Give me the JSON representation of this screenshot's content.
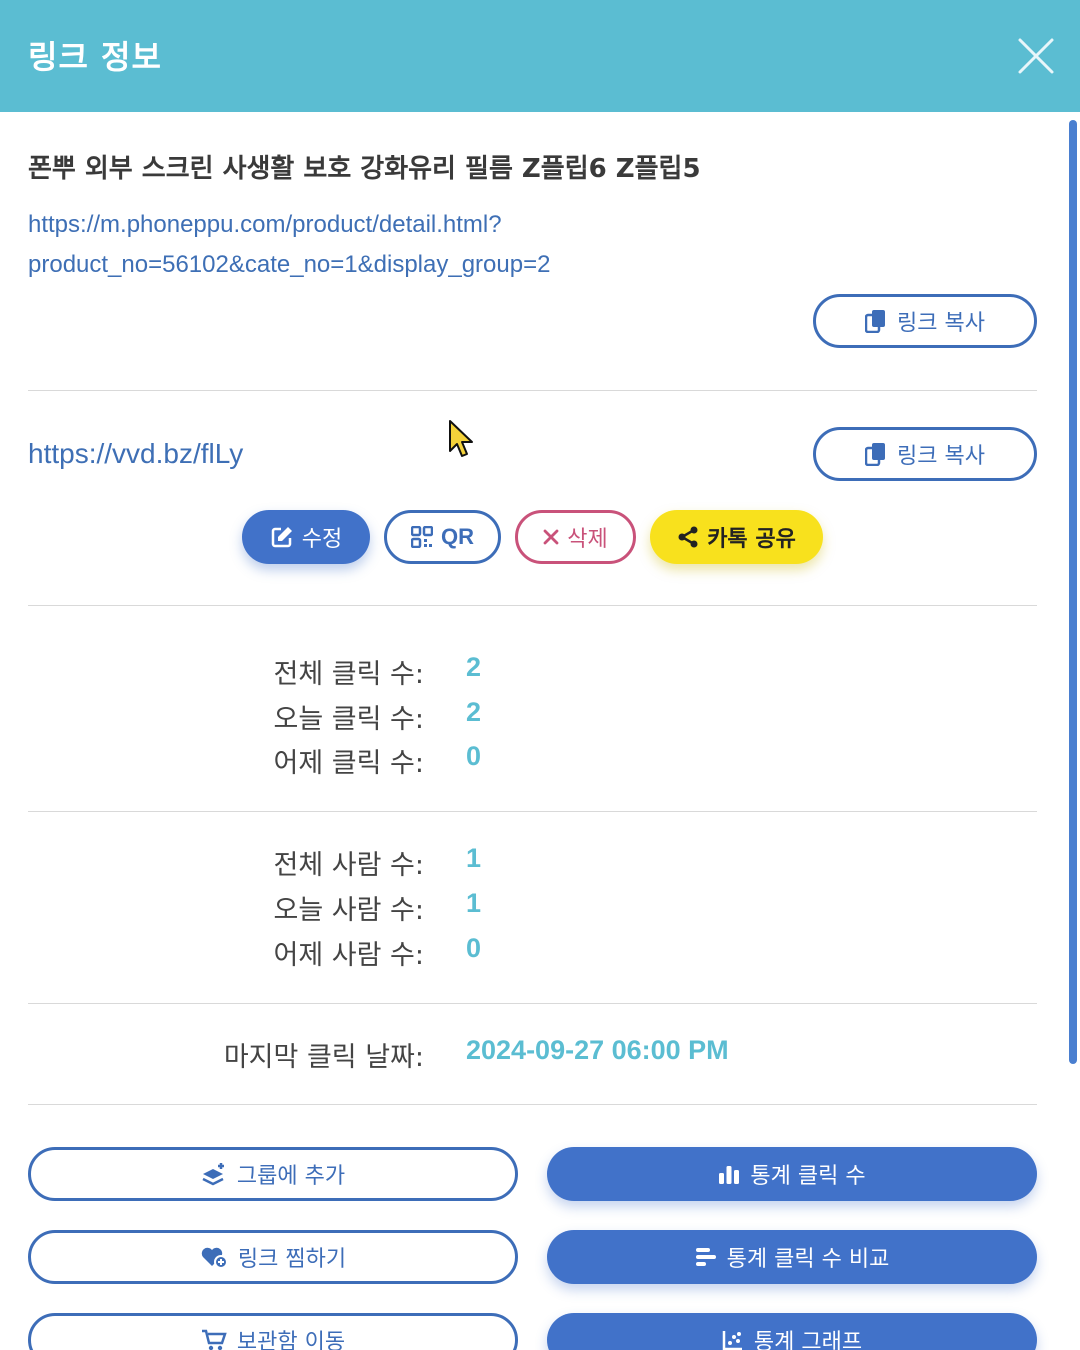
{
  "header": {
    "title": "링크 정보"
  },
  "product": {
    "title": "폰뿌 외부 스크린 사생활 보호 강화유리 필름 Z플립6 Z플립5",
    "url_line1": "https://m.phoneppu.com/product/detail.html?",
    "url_line2": "product_no=56102&cate_no=1&display_group=2",
    "copy_label": "링크 복사"
  },
  "short_link": {
    "url": "https://vvd.bz/flLy",
    "copy_label": "링크 복사"
  },
  "actions": {
    "edit": "수정",
    "qr": "QR",
    "delete": "삭제",
    "kakao": "카톡 공유"
  },
  "clicks": {
    "total_label": "전체 클릭 수:",
    "total_value": "2",
    "today_label": "오늘 클릭 수:",
    "today_value": "2",
    "yesterday_label": "어제 클릭 수:",
    "yesterday_value": "0"
  },
  "people": {
    "total_label": "전체 사람 수:",
    "total_value": "1",
    "today_label": "오늘 사람 수:",
    "today_value": "1",
    "yesterday_label": "어제 사람 수:",
    "yesterday_value": "0"
  },
  "last_click": {
    "label": "마지막 클릭 날짜:",
    "value": "2024-09-27 06:00 PM"
  },
  "bottom_buttons": {
    "add_group": "그룹에 추가",
    "stats_clicks": "통계 클릭 수",
    "favorite": "링크 찜하기",
    "stats_compare": "통계 클릭 수 비교",
    "move_archive": "보관함 이동",
    "stats_graph": "통계 그래프"
  },
  "colors": {
    "header": "#5bbdd2",
    "primary": "#4172c9",
    "danger": "#c9527a",
    "kakao": "#f8e11d",
    "stat_value": "#5bbdd2"
  },
  "icons": [
    "close-icon",
    "copy-icon",
    "edit-icon",
    "qr-icon",
    "x-icon",
    "share-icon",
    "layers-icon",
    "bar-chart-icon",
    "heart-icon",
    "list-bars-icon",
    "cart-icon",
    "scatter-icon",
    "cursor-icon"
  ]
}
